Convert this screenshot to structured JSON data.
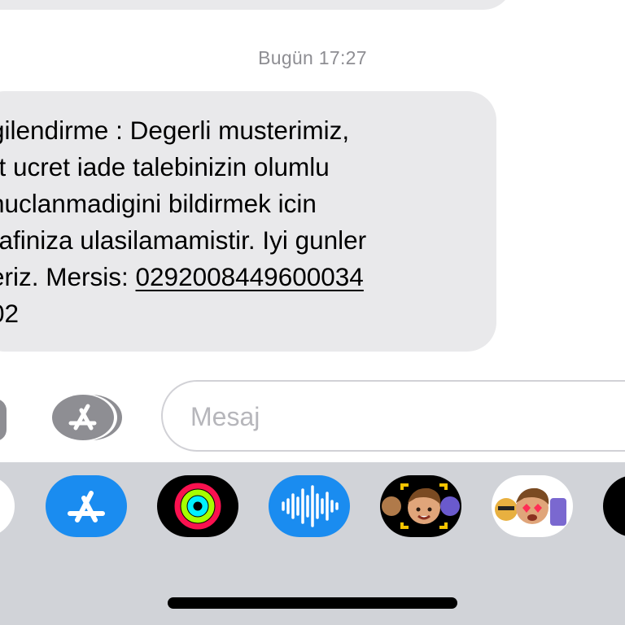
{
  "conversation": {
    "timestamp": "Bugün 17:27",
    "message_lines": [
      "gilendirme : Degerli musterimiz,",
      "rt ucret iade talebinizin olumlu",
      "nuclanmadigini bildirmek icin",
      "rafiniza ulasilamamistir. Iyi gunler",
      "eriz. Mersis: ",
      "02"
    ],
    "mersis_link": "0292008449600034"
  },
  "input_bar": {
    "placeholder": "Mesaj"
  },
  "app_drawer": {
    "apps": [
      {
        "name": "photos-app",
        "icon": "photos-icon"
      },
      {
        "name": "app-store",
        "icon": "app-store-icon"
      },
      {
        "name": "fitness-activity",
        "icon": "activity-rings-icon"
      },
      {
        "name": "audio-message",
        "icon": "waveform-icon"
      },
      {
        "name": "memoji-camera",
        "icon": "memoji-icon"
      },
      {
        "name": "memoji-stickers",
        "icon": "memoji-stickers-icon"
      },
      {
        "name": "more-app",
        "icon": "app-icon"
      }
    ]
  },
  "colors": {
    "bubble": "#e9e9eb",
    "app_store_blue": "#1a8cf0",
    "drawer": "#d1d3d8"
  }
}
